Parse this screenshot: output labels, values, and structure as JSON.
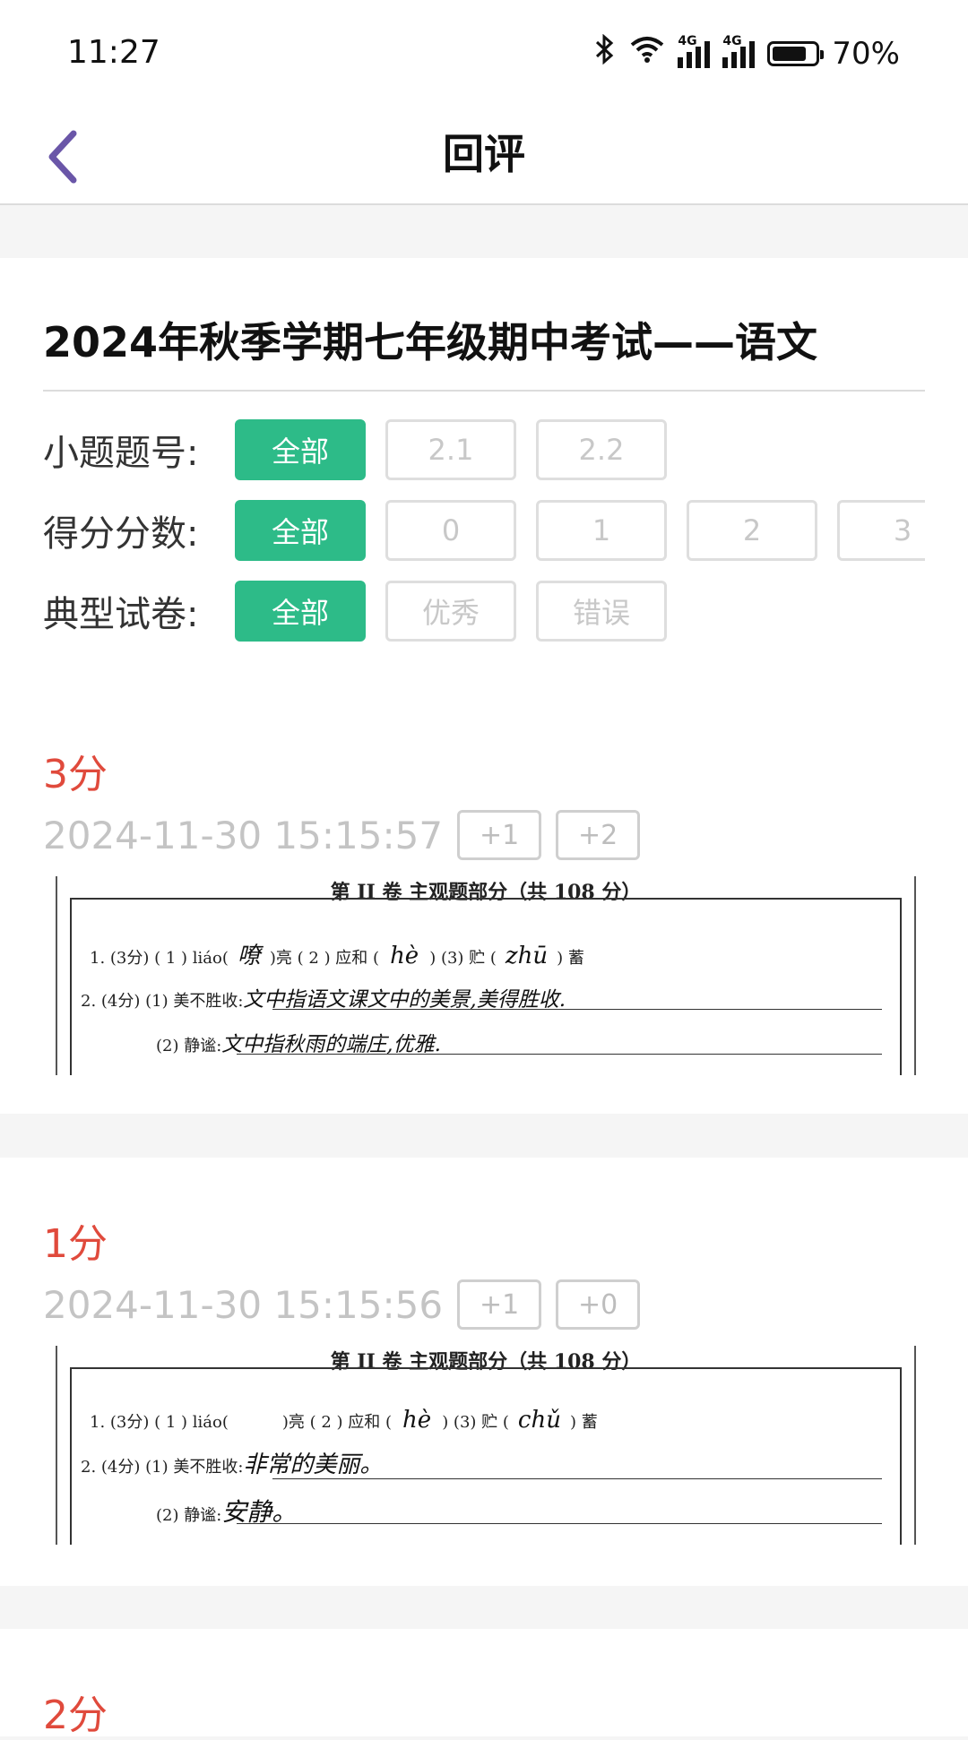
{
  "status": {
    "time": "11:27",
    "battery": "70%",
    "network1": "4G",
    "network2": "4G"
  },
  "nav": {
    "title": "回评"
  },
  "exam_title": "2024年秋季学期七年级期中考试——语文",
  "filters": {
    "question": {
      "label": "小题题号:",
      "options": [
        "全部",
        "2.1",
        "2.2"
      ]
    },
    "score": {
      "label": "得分分数:",
      "options": [
        "全部",
        "0",
        "1",
        "2",
        "3"
      ]
    },
    "typical": {
      "label": "典型试卷:",
      "options": [
        "全部",
        "优秀",
        "错误"
      ]
    }
  },
  "records": [
    {
      "score": "3分",
      "time": "2024-11-30 15:15:57",
      "buttons": [
        "+1",
        "+2"
      ],
      "scan": {
        "header": "第 II 卷  主观题部分（共 108 分）",
        "q1_prefix": "1. (3分)  ( 1 ) liáo(",
        "q1_ans1": "嘹",
        "q1_mid": ")亮    ( 2 ) 应和 (",
        "q1_ans2": "hè",
        "q1_mid2": ")    (3) 贮 (",
        "q1_ans3": "zhū",
        "q1_end": ")  蓄",
        "q2_label": "2. (4分) (1) 美不胜收:",
        "q2_ans": "文中指语文课文中的美景,美得胜收.",
        "q3_label": "(2) 静谧:",
        "q3_ans": "文中指秋雨的端庄,优雅."
      }
    },
    {
      "score": "1分",
      "time": "2024-11-30 15:15:56",
      "buttons": [
        "+1",
        "+0"
      ],
      "scan": {
        "header": "第 II 卷  主观题部分（共 108 分）",
        "q1_prefix": "1. (3分)  ( 1 ) liáo(",
        "q1_ans1": "",
        "q1_mid": ")亮    ( 2 ) 应和 (",
        "q1_ans2": "hè",
        "q1_mid2": ")    (3) 贮 (",
        "q1_ans3": "chǔ",
        "q1_end": ")  蓄",
        "q2_label": "2. (4分) (1) 美不胜收:",
        "q2_ans": "非常的美丽。",
        "q3_label": "(2) 静谧:",
        "q3_ans": "安静。"
      }
    },
    {
      "score": "2分"
    }
  ]
}
